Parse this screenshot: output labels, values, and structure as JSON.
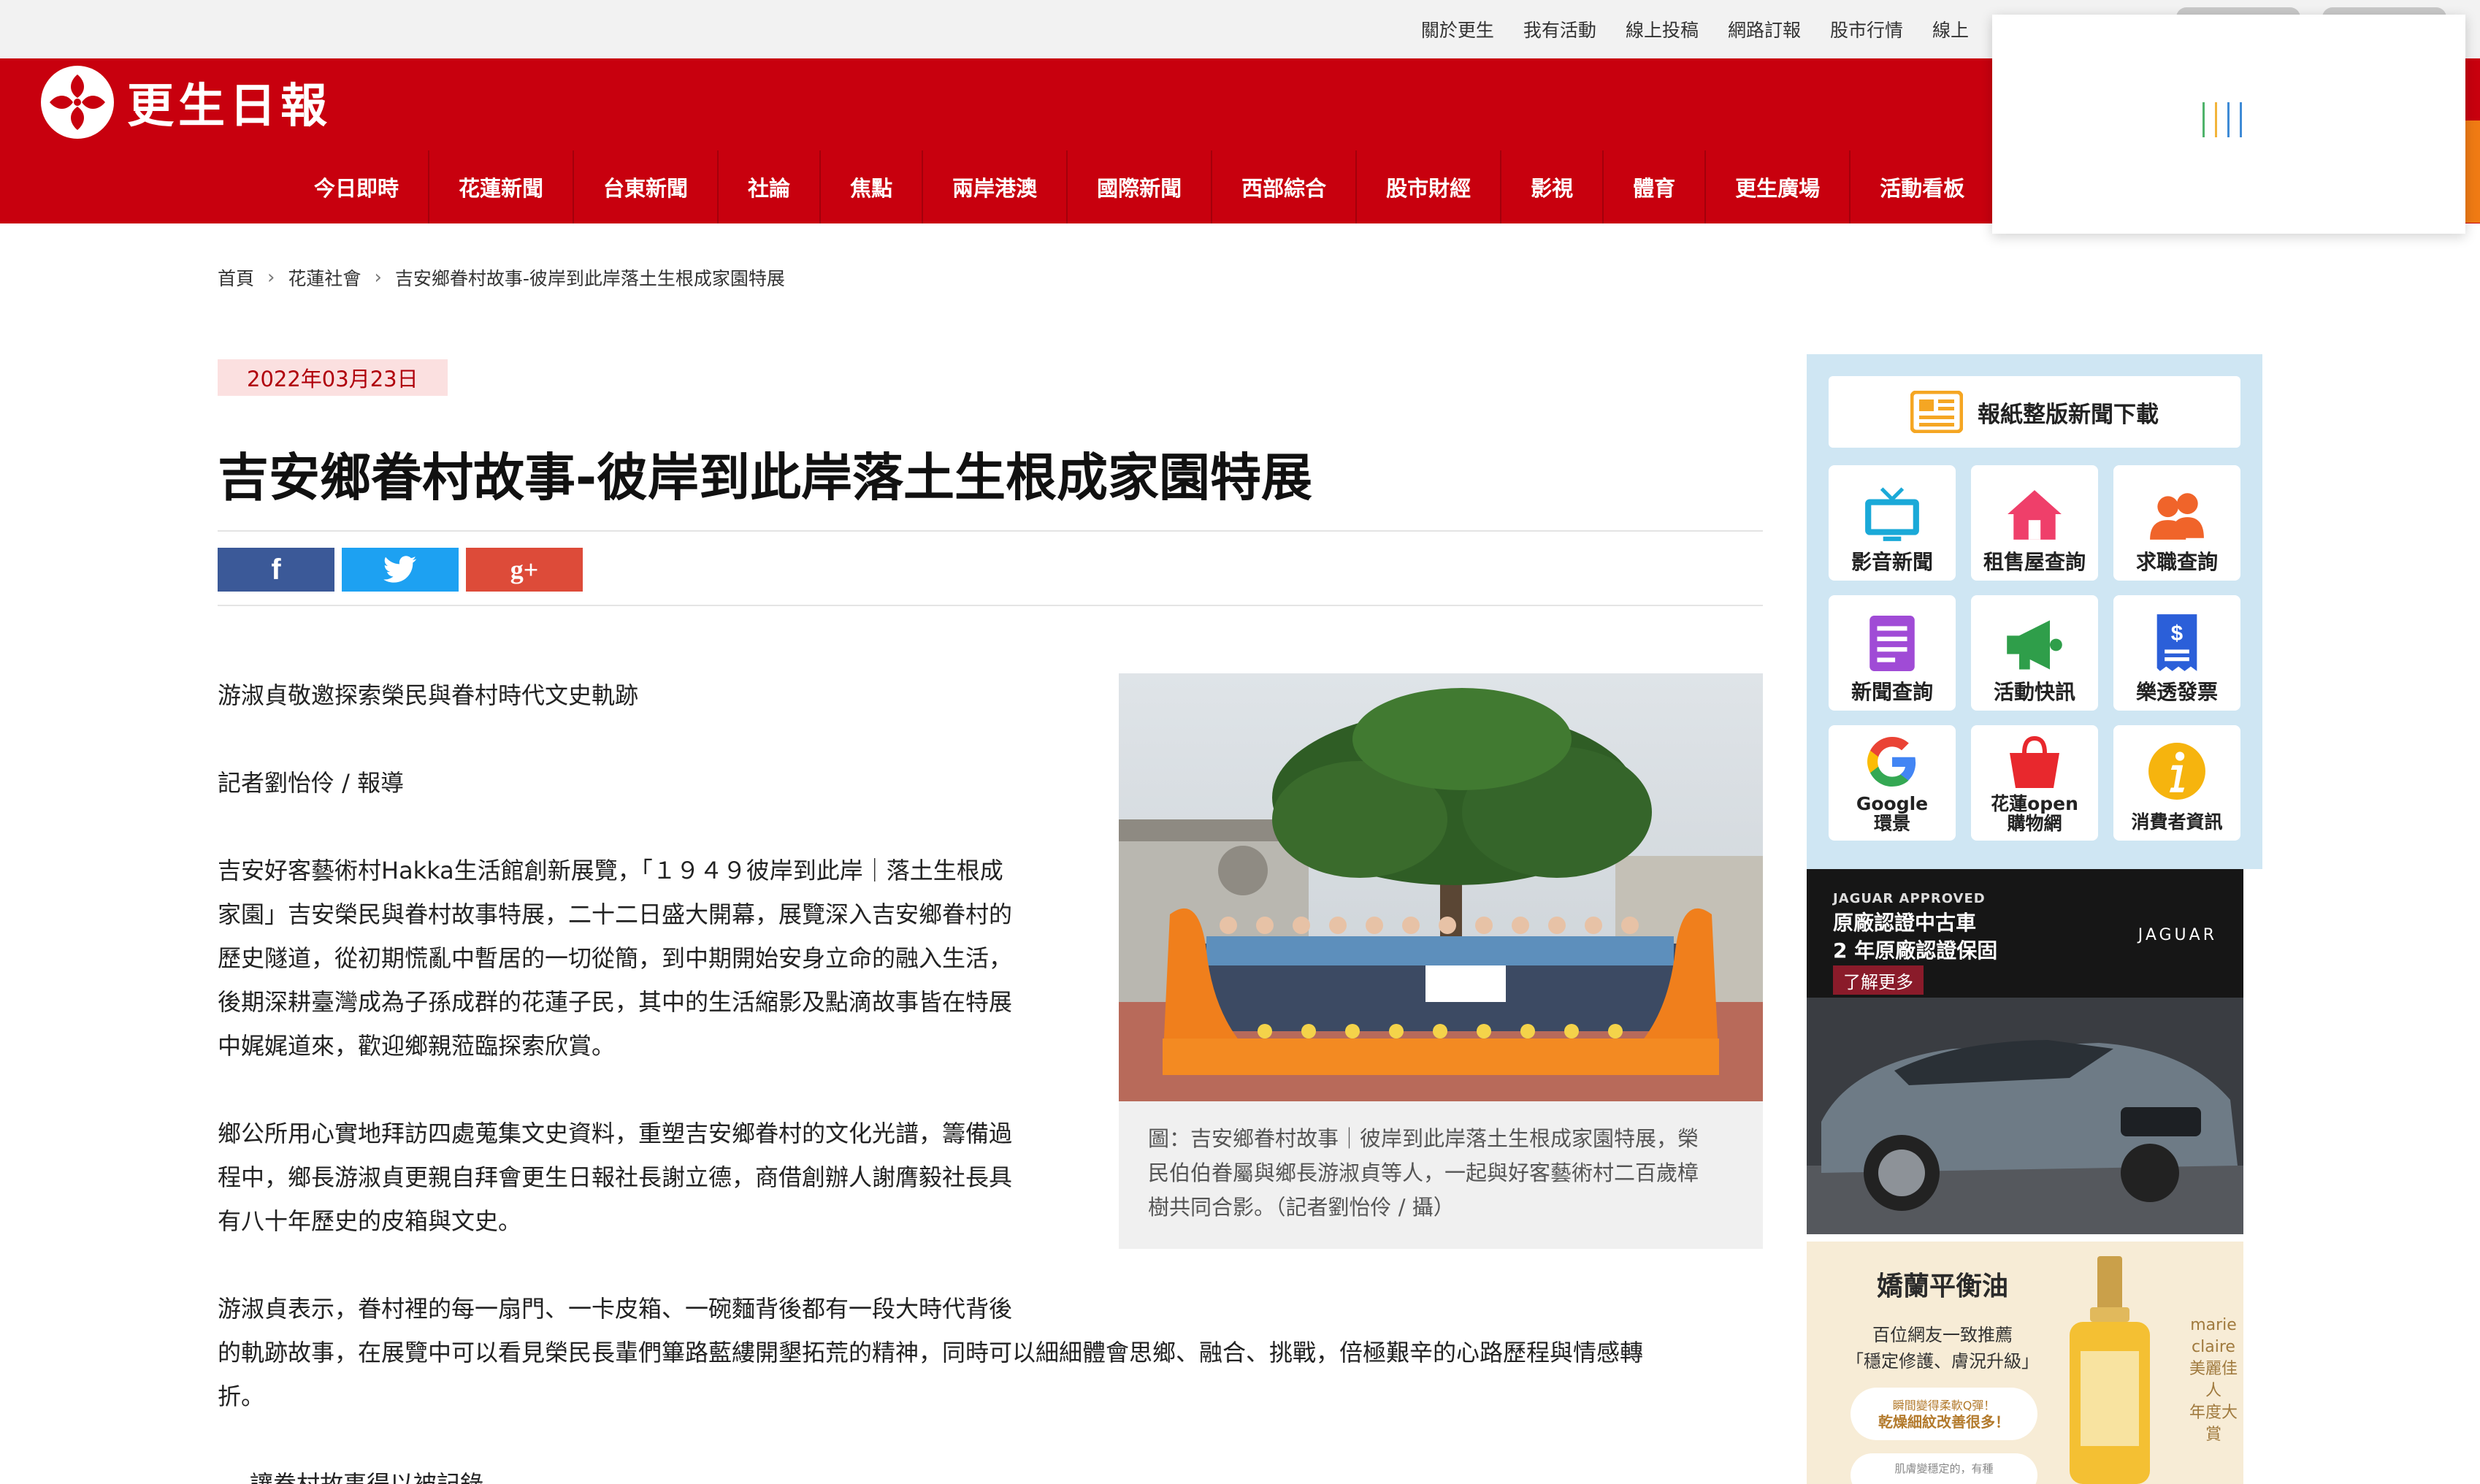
{
  "topbar": {
    "links": [
      "關於更生",
      "我有活動",
      "線上投稿",
      "網路訂報",
      "股市行情",
      "線上"
    ]
  },
  "header": {
    "logo_text": "更生日報",
    "nav": [
      "今日即時",
      "花蓮新聞",
      "台東新聞",
      "社論",
      "焦點",
      "兩岸港澳",
      "國際新聞",
      "西部綜合",
      "股市財經",
      "影視",
      "體育",
      "更生廣場",
      "活動看板"
    ]
  },
  "breadcrumb": [
    "首頁",
    "花蓮社會",
    "吉安鄉眷村故事-彼岸到此岸落土生根成家園特展"
  ],
  "article": {
    "date": "2022年03月23日",
    "title": "吉安鄉眷村故事-彼岸到此岸落土生根成家園特展",
    "share": {
      "facebook": "f",
      "googleplus": "g+"
    },
    "subtitle": "游淑貞敬邀探索榮民與眷村時代文史軌跡",
    "byline": "記者劉怡伶 / 報導",
    "p1_lines": [
      "吉安好客藝術村Hakka生活館創新展覽，「１９４９彼岸到此岸｜落土生根成",
      "家園」吉安榮民與眷村故事特展，二十二日盛大開幕，展覽深入吉安鄉眷村的",
      "歷史隧道，從初期慌亂中暫居的一切從簡，到中期開始安身立命的融入生活，",
      "後期深耕臺灣成為子孫成群的花蓮子民，其中的生活縮影及點滴故事皆在特展",
      "中娓娓道來，歡迎鄉親蒞臨探索欣賞。"
    ],
    "p2_lines": [
      "鄉公所用心實地拜訪四處蒐集文史資料，重塑吉安鄉眷村的文化光譜，籌備過",
      "程中，鄉長游淑貞更親自拜會更生日報社長謝立德，商借創辦人謝膺毅社長具",
      "有八十年歷史的皮箱與文史。"
    ],
    "p3_lines": [
      "游淑貞表示，眷村裡的每一扇門、一卡皮箱、一碗麵背後都有一段大時代背後",
      "的軌跡故事，在展覽中可以看見榮民長輩們篳路藍縷開墾拓荒的精神，同時可以細細體會思鄉、融合、挑戰，倍極艱辛的心路歷程與情感轉",
      "折。"
    ],
    "p4_partial": "讓眷村故事得以被記錄",
    "figure_caption_lines": [
      "圖：吉安鄉眷村故事｜彼岸到此岸落土生根成家園特展，榮",
      "民伯伯眷屬與鄉長游淑貞等人，一起與好客藝術村二百歲樟",
      "樹共同合影。（記者劉怡伶 / 攝）"
    ]
  },
  "sidebar": {
    "paper_download": "報紙整版新聞下載",
    "tiles": [
      {
        "label": "影音新聞",
        "icon": "tv-icon"
      },
      {
        "label": "租售屋查詢",
        "icon": "house-icon"
      },
      {
        "label": "求職查詢",
        "icon": "people-icon"
      },
      {
        "label": "新聞查詢",
        "icon": "document-icon"
      },
      {
        "label": "活動快訊",
        "icon": "megaphone-icon"
      },
      {
        "label": "樂透發票",
        "icon": "receipt-icon"
      },
      {
        "label": "Google\n環景",
        "icon": "google-icon"
      },
      {
        "label": "花蓮open\n購物網",
        "icon": "shopping-bag-icon"
      },
      {
        "label": "消費者資訊",
        "icon": "info-icon"
      }
    ]
  },
  "ads": {
    "jaguar": {
      "small": "JAGUAR APPROVED",
      "line1": "原廠認證中古車",
      "line2": "2 年原廠認證保固",
      "cta": "了解更多",
      "brand": "JAGUAR"
    },
    "lancome": {
      "title": "嬌蘭平衡油",
      "line1": "百位網友一致推薦",
      "line2": "「穩定修護、膚況升級」",
      "bubble_a": "瞬間變得柔軟Q彈！",
      "bubble_b": "乾燥細紋改善很多！",
      "bubble2": "肌膚變穩定的，有種",
      "mc1": "marie claire",
      "mc2": "美麗佳人",
      "mc3": "年度大賞"
    }
  },
  "colors": {
    "brand_red": "#c8000e",
    "facebook": "#3b5998",
    "twitter": "#1da1f2",
    "googleplus": "#dd4b39",
    "sidebar_bg": "#cfe6f3",
    "date_badge_bg": "#fbe0e0"
  }
}
